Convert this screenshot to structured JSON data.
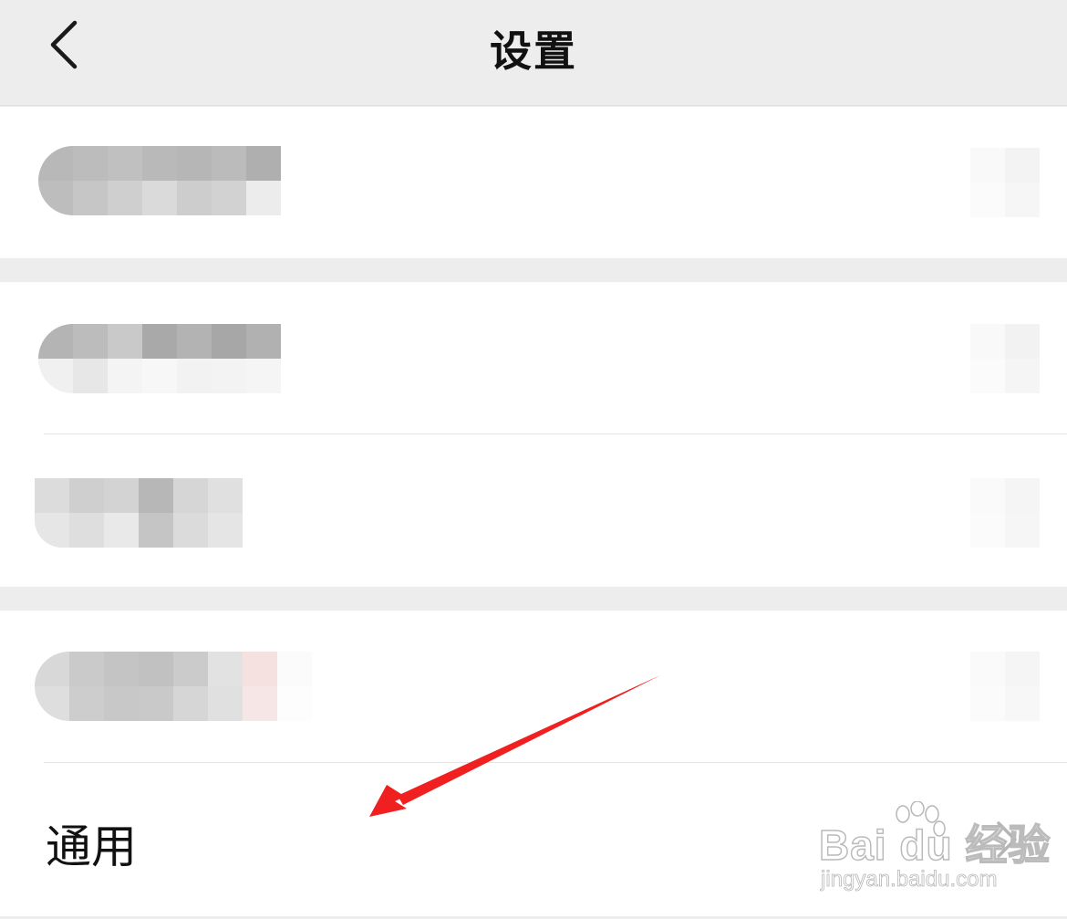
{
  "nav": {
    "title": "设置",
    "back_icon": "chevron-left-icon"
  },
  "rows": {
    "general_label": "通用",
    "general_chevron_icon": "chevron-right-icon"
  },
  "annotation": {
    "arrow_color": "#f02020"
  },
  "watermark": {
    "line1": "Bai du 经验",
    "line2": "jingyan.baidu.com"
  }
}
